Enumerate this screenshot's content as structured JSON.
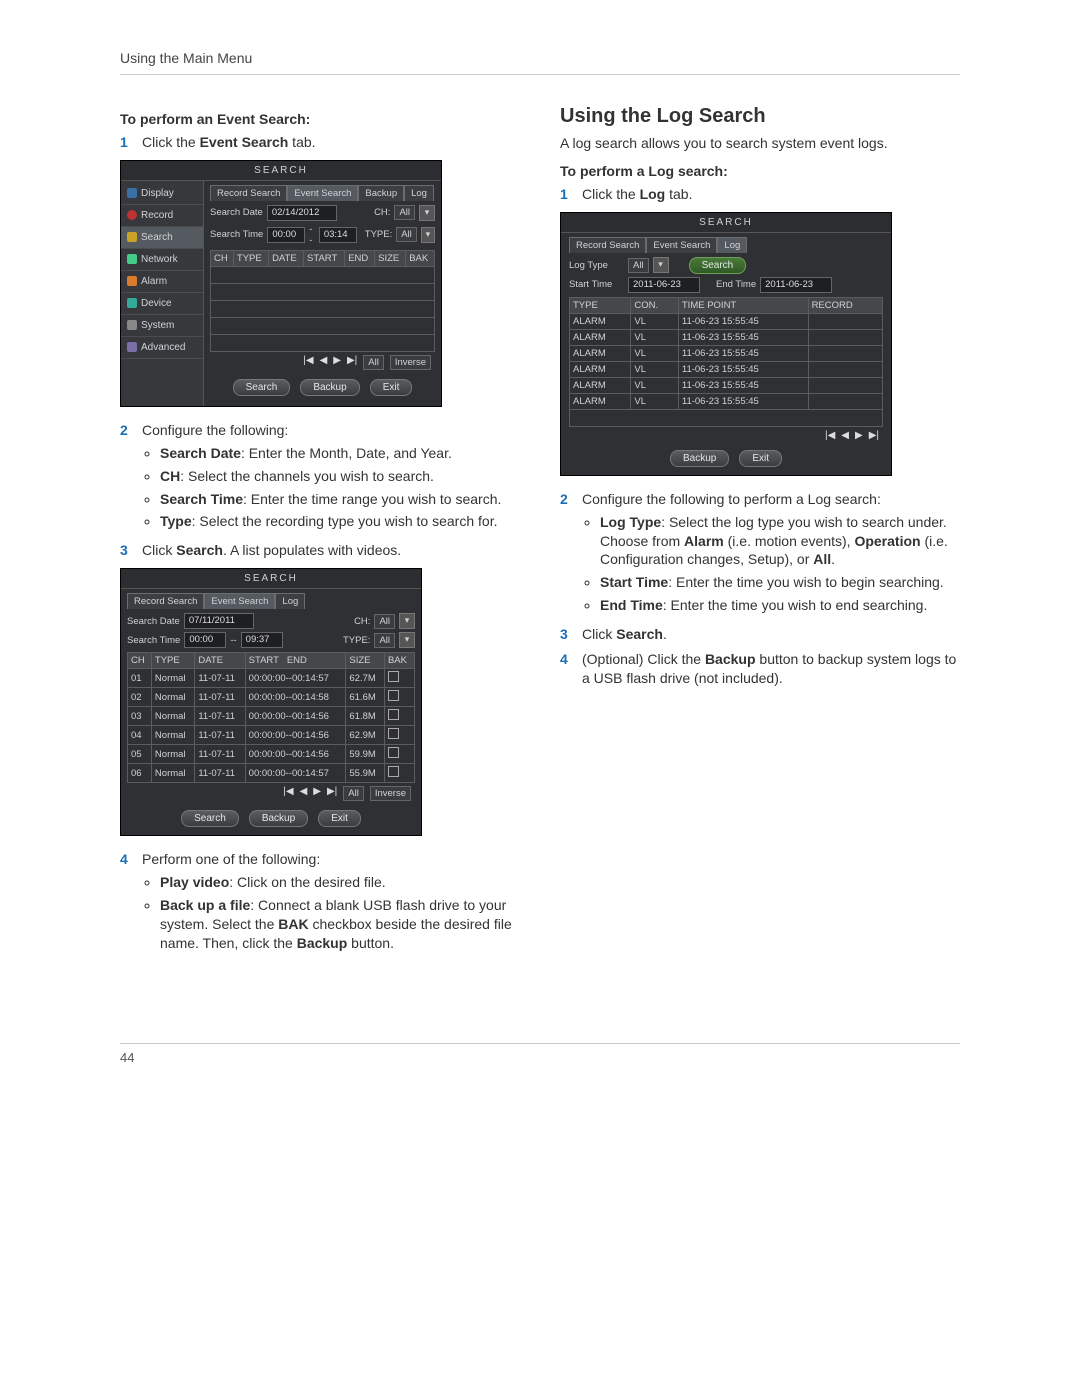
{
  "header": "Using the Main Menu",
  "page_number": "44",
  "left": {
    "subhead1": "To perform an Event Search:",
    "step1_num": "1",
    "step1_pre": "Click the ",
    "step1_bold": "Event Search",
    "step1_post": " tab.",
    "step2_num": "2",
    "step2_text": "Configure the following:",
    "step2_b1_bold": "Search Date",
    "step2_b1_rest": ": Enter the Month, Date, and Year.",
    "step2_b2_bold": "CH",
    "step2_b2_rest": ": Select the channels you wish to search.",
    "step2_b3_bold": "Search Time",
    "step2_b3_rest": ": Enter the time range you wish to search.",
    "step2_b4_bold": "Type",
    "step2_b4_rest": ": Select the recording type you wish to search for.",
    "step3_num": "3",
    "step3_pre": "Click ",
    "step3_bold": "Search",
    "step3_post": ". A list populates with videos.",
    "step4_num": "4",
    "step4_text": "Perform one of the following:",
    "step4_b1_bold": "Play video",
    "step4_b1_rest": ": Click on the desired file.",
    "step4_b2_bold": "Back up a file",
    "step4_b2_rest_a": ": Connect a blank USB flash drive to your system. Select the ",
    "step4_b2_bold2": "BAK",
    "step4_b2_rest_b": " checkbox beside the desired file name. Then, click the ",
    "step4_b2_bold3": "Backup",
    "step4_b2_rest_c": " button."
  },
  "right": {
    "title": "Using the Log Search",
    "intro": "A log search allows you to search system event logs.",
    "subhead": "To perform a Log search:",
    "step1_num": "1",
    "step1_pre": "Click the ",
    "step1_bold": "Log",
    "step1_post": " tab.",
    "step2_num": "2",
    "step2_text": "Configure the following to perform a Log search:",
    "step2_b1_bold": "Log Type",
    "step2_b1_rest_a": ": Select the log type you wish to search under. Choose from ",
    "step2_b1_bold_a": "Alarm",
    "step2_b1_rest_b": " (i.e. motion events), ",
    "step2_b1_bold_b": "Operation",
    "step2_b1_rest_c": " (i.e. Configuration changes, Setup), or ",
    "step2_b1_bold_c": "All",
    "step2_b1_rest_d": ".",
    "step2_b2_bold": "Start Time",
    "step2_b2_rest": ": Enter the time you wish to begin searching.",
    "step2_b3_bold": "End Time",
    "step2_b3_rest": ": Enter the time you wish to end searching.",
    "step3_num": "3",
    "step3_pre": "Click ",
    "step3_bold": "Search",
    "step3_post": ".",
    "step4_num": "4",
    "step4_pre": "(Optional) Click the ",
    "step4_bold": "Backup",
    "step4_post": " button to backup system logs to a USB flash drive (not included)."
  },
  "shot1": {
    "title": "SEARCH",
    "side": [
      "Display",
      "Record",
      "Search",
      "Network",
      "Alarm",
      "Device",
      "System",
      "Advanced"
    ],
    "tabs": [
      "Record Search",
      "Event Search",
      "Backup",
      "Log"
    ],
    "search_date_label": "Search Date",
    "search_date": "02/14/2012",
    "ch_label": "CH:",
    "ch_value": "All",
    "search_time_label": "Search Time",
    "time_from": "00:00",
    "time_sep": "--",
    "time_to": "03:14",
    "type_label": "TYPE:",
    "type_value": "All",
    "cols": [
      "CH",
      "TYPE",
      "DATE",
      "START",
      "END",
      "SIZE",
      "BAK"
    ],
    "pager": [
      "|◀",
      "◀",
      "▶",
      "▶|",
      "All",
      "Inverse"
    ],
    "buttons": [
      "Search",
      "Backup",
      "Exit"
    ]
  },
  "shot2": {
    "title": "SEARCH",
    "tabs": [
      "Record Search",
      "Event Search",
      "Log"
    ],
    "search_date_label": "Search Date",
    "search_date": "07/11/2011",
    "ch_label": "CH:",
    "ch_value": "All",
    "search_time_label": "Search Time",
    "time_from": "00:00",
    "time_sep": "--",
    "time_to": "09:37",
    "type_label": "TYPE:",
    "type_value": "All",
    "cols": [
      "CH",
      "TYPE",
      "DATE",
      "START",
      "END",
      "SIZE",
      "BAK"
    ],
    "rows": [
      {
        "ch": "01",
        "type": "Normal",
        "date": "11-07-11",
        "start": "00:00:00--00:14:57",
        "size": "62.7M"
      },
      {
        "ch": "02",
        "type": "Normal",
        "date": "11-07-11",
        "start": "00:00:00--00:14:58",
        "size": "61.6M"
      },
      {
        "ch": "03",
        "type": "Normal",
        "date": "11-07-11",
        "start": "00:00:00--00:14:56",
        "size": "61.8M"
      },
      {
        "ch": "04",
        "type": "Normal",
        "date": "11-07-11",
        "start": "00:00:00--00:14:56",
        "size": "62.9M"
      },
      {
        "ch": "05",
        "type": "Normal",
        "date": "11-07-11",
        "start": "00:00:00--00:14:56",
        "size": "59.9M"
      },
      {
        "ch": "06",
        "type": "Normal",
        "date": "11-07-11",
        "start": "00:00:00--00:14:57",
        "size": "55.9M"
      }
    ],
    "pager": [
      "|◀",
      "◀",
      "▶",
      "▶|",
      "All",
      "Inverse"
    ],
    "buttons": [
      "Search",
      "Backup",
      "Exit"
    ]
  },
  "shot3": {
    "title": "SEARCH",
    "tabs": [
      "Record Search",
      "Event Search",
      "Log"
    ],
    "log_type_label": "Log Type",
    "log_type_value": "All",
    "search_btn": "Search",
    "start_time_label": "Start Time",
    "start_time": "2011-06-23",
    "end_time_label": "End Time",
    "end_time": "2011-06-23",
    "cols": [
      "TYPE",
      "CON.",
      "TIME POINT",
      "RECORD"
    ],
    "rows": [
      {
        "type": "ALARM",
        "con": "VL",
        "tp": "11-06-23  15:55:45"
      },
      {
        "type": "ALARM",
        "con": "VL",
        "tp": "11-06-23  15:55:45"
      },
      {
        "type": "ALARM",
        "con": "VL",
        "tp": "11-06-23  15:55:45"
      },
      {
        "type": "ALARM",
        "con": "VL",
        "tp": "11-06-23  15:55:45"
      },
      {
        "type": "ALARM",
        "con": "VL",
        "tp": "11-06-23  15:55:45"
      },
      {
        "type": "ALARM",
        "con": "VL",
        "tp": "11-06-23  15:55:45"
      }
    ],
    "pager": [
      "|◀",
      "◀",
      "▶",
      "▶|"
    ],
    "buttons": [
      "Backup",
      "Exit"
    ]
  }
}
